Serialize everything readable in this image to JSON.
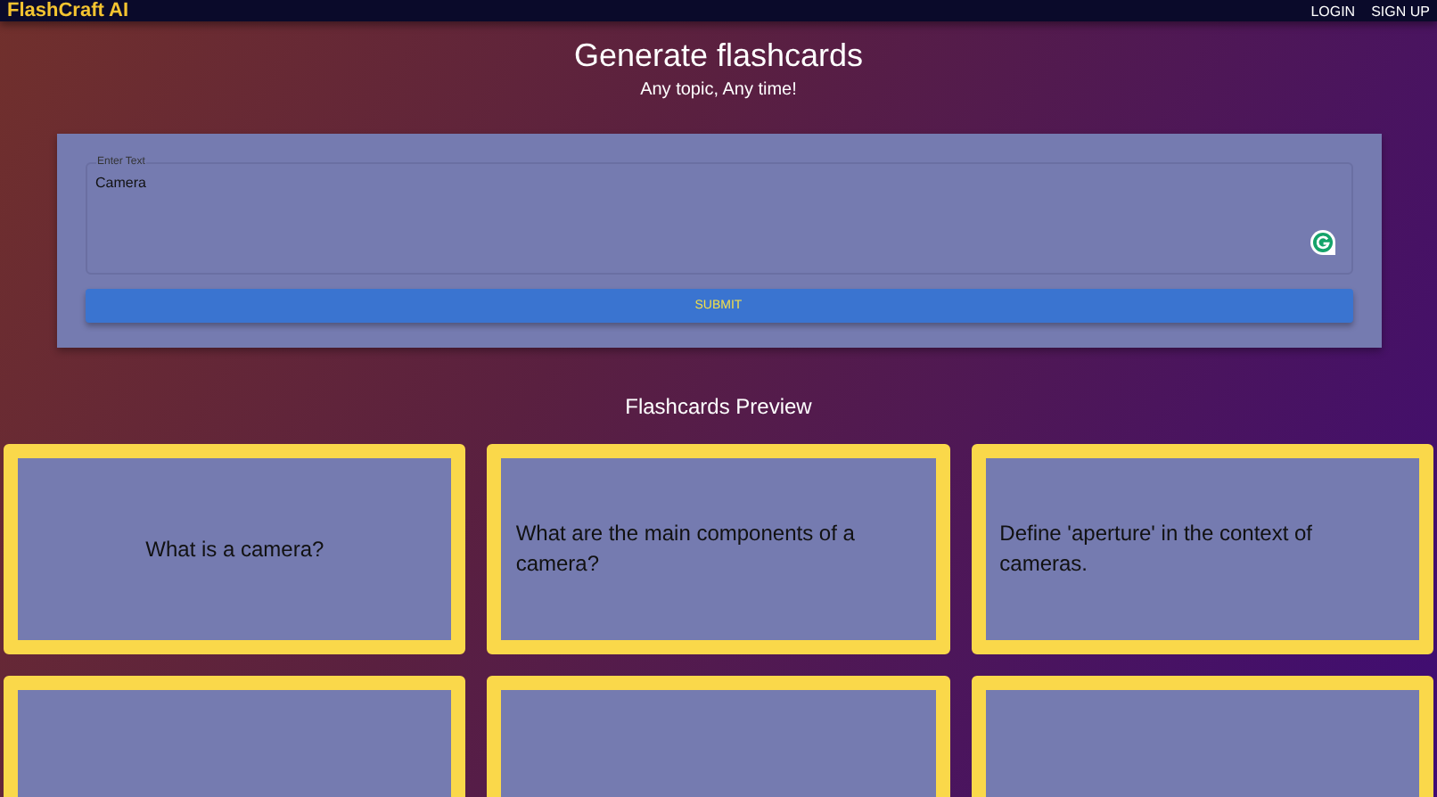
{
  "navbar": {
    "brand": "FlashCraft AI",
    "links": [
      "LOGIN",
      "SIGN UP"
    ]
  },
  "header": {
    "title": "Generate flashcards",
    "subtitle": "Any topic, Any time!"
  },
  "form": {
    "label": "Enter Text",
    "value": "Camera",
    "submit": "SUBMIT"
  },
  "preview": {
    "title": "Flashcards Preview",
    "cards": [
      {
        "kind": "centered",
        "text": "What is a camera?"
      },
      {
        "kind": "left",
        "text": "What are the main components of a camera?"
      },
      {
        "kind": "left",
        "text": "Define 'aperture' in the context of cameras."
      },
      {
        "kind": "blank"
      },
      {
        "kind": "blank"
      },
      {
        "kind": "blank"
      }
    ]
  }
}
